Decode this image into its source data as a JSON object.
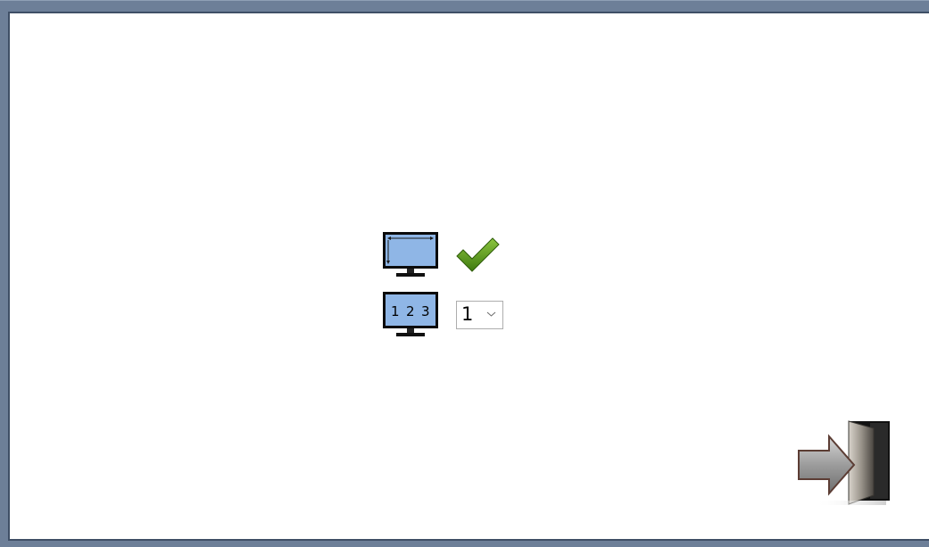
{
  "display": {
    "fullscreen_icon": "monitor-fullscreen-icon",
    "fullscreen_status_icon": "checkmark-icon",
    "fullscreen_enabled": true,
    "monitor_select_icon": "monitor-numbers-icon",
    "monitor_icon_digits": [
      "1",
      "2",
      "3"
    ],
    "monitor_selected": "1",
    "monitor_chevron_icon": "chevron-down-icon"
  },
  "exit": {
    "icon": "exit-door-icon"
  },
  "colors": {
    "frame": "#6d7f98",
    "panel_border": "#3f4f66",
    "screen_blue": "#8fb6e6",
    "check_green": "#5a8f1a"
  }
}
